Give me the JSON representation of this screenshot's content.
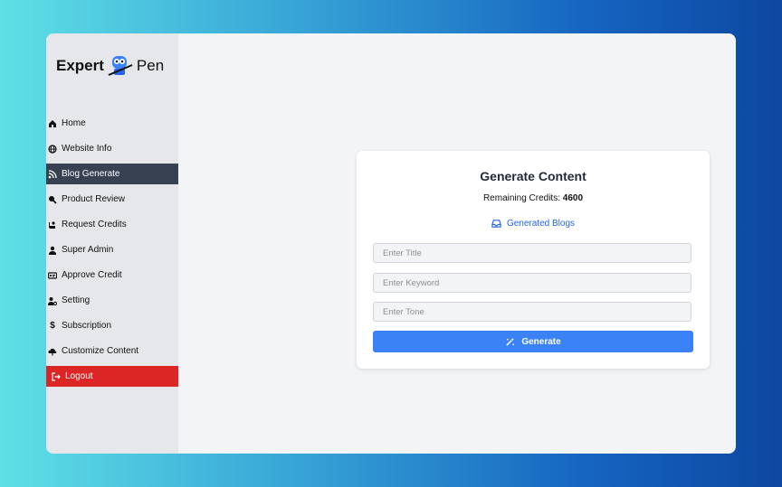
{
  "logo": {
    "part1": "Expert",
    "part2": "Pen"
  },
  "sidebar": {
    "items": [
      {
        "label": "Home",
        "icon": "home-icon"
      },
      {
        "label": "Website Info",
        "icon": "globe-icon"
      },
      {
        "label": "Blog Generate",
        "icon": "blog-icon",
        "active": true
      },
      {
        "label": "Product Review",
        "icon": "search-icon"
      },
      {
        "label": "Request Credits",
        "icon": "hand-icon"
      },
      {
        "label": "Super Admin",
        "icon": "user-icon"
      },
      {
        "label": "Approve Credit",
        "icon": "card-icon"
      },
      {
        "label": "Setting",
        "icon": "user-gear-icon"
      },
      {
        "label": "Subscription",
        "icon": "dollar-icon"
      },
      {
        "label": "Customize Content",
        "icon": "cloud-icon"
      }
    ],
    "logout": "Logout"
  },
  "card": {
    "title": "Generate Content",
    "credits_label": "Remaining Credits:",
    "credits_value": "4600",
    "generated_link": "Generated Blogs",
    "title_placeholder": "Enter Title",
    "keyword_placeholder": "Enter Keyword",
    "tone_placeholder": "Enter Tone",
    "generate_label": "Generate"
  },
  "colors": {
    "active_nav": "#374151",
    "logout": "#dc2626",
    "primary": "#3b82f6",
    "link": "#2563eb"
  }
}
